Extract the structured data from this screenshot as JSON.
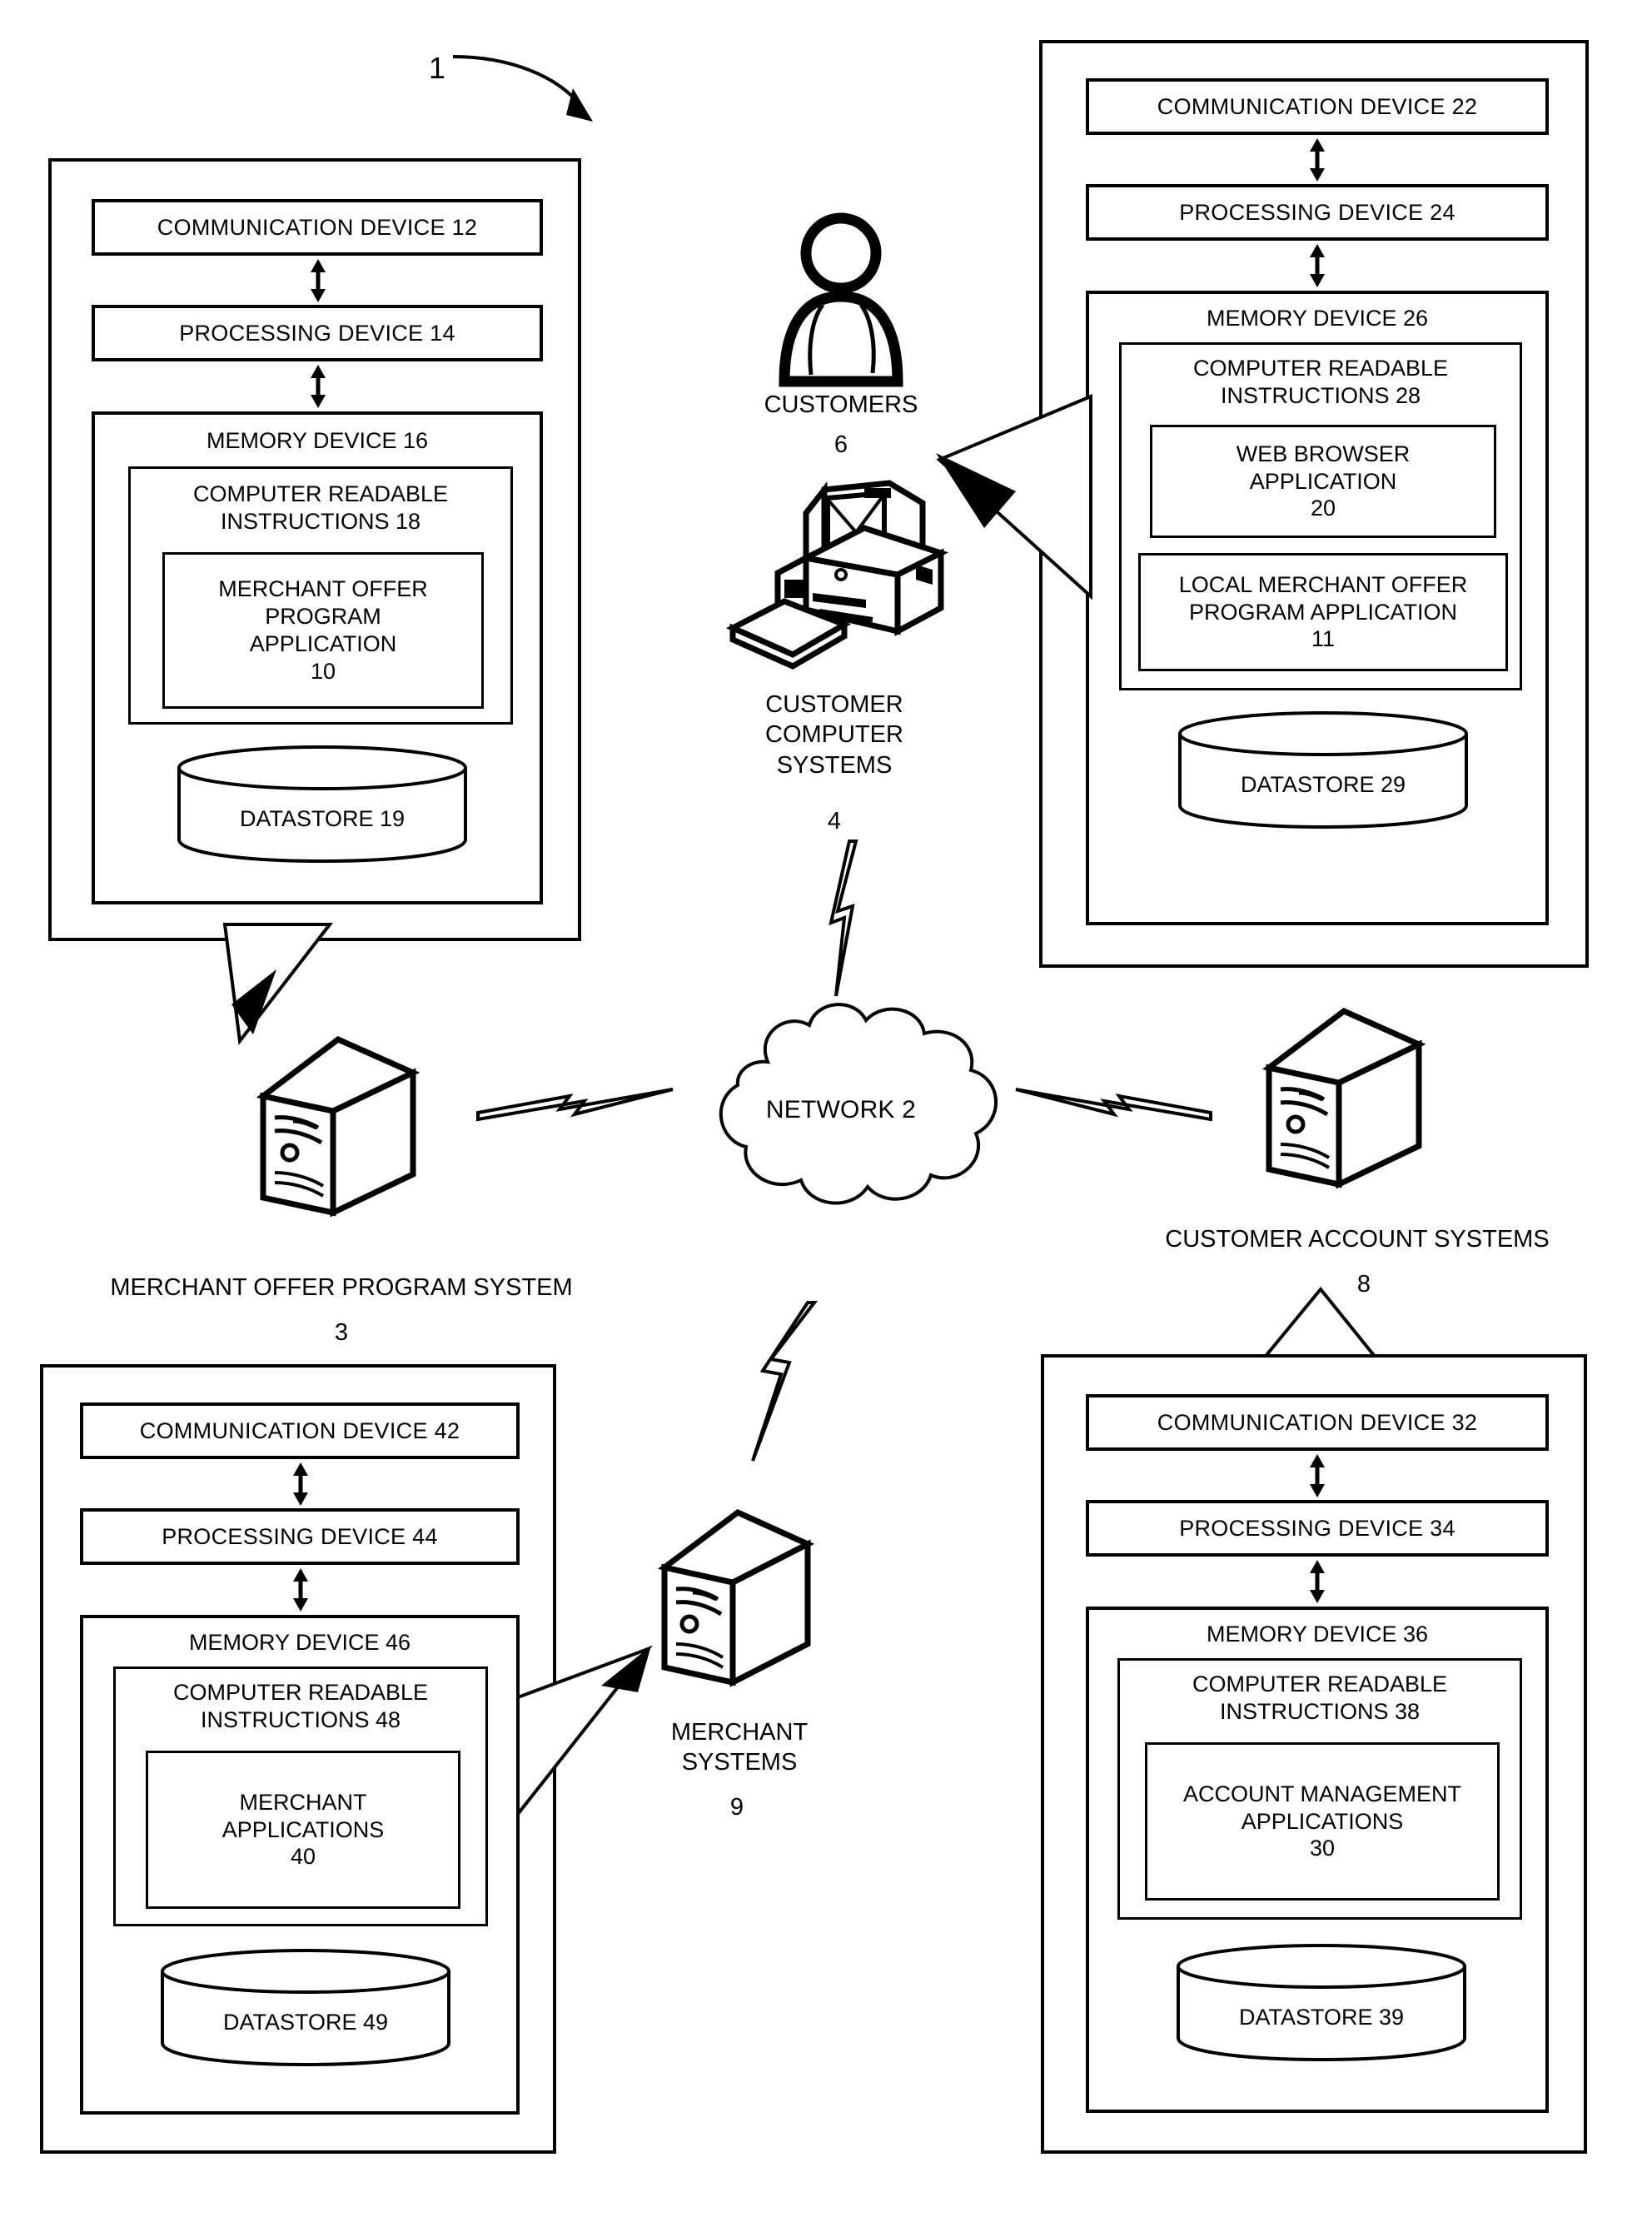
{
  "figure": {
    "number": "1",
    "title": "System architecture diagram"
  },
  "systems": {
    "merchant_offer_program_system": {
      "name": "MERCHANT OFFER PROGRAM SYSTEM",
      "ref": "3",
      "communication_device": "COMMUNICATION DEVICE 12",
      "processing_device": "PROCESSING DEVICE 14",
      "memory_device": "MEMORY DEVICE 16",
      "computer_readable_instructions": "COMPUTER READABLE\nINSTRUCTIONS 18",
      "application": "MERCHANT OFFER\nPROGRAM\nAPPLICATION\n10",
      "datastore": "DATASTORE 19"
    },
    "customer_computer_systems": {
      "name": "CUSTOMER\nCOMPUTER\nSYSTEMS",
      "ref": "4",
      "communication_device": "COMMUNICATION DEVICE 22",
      "processing_device": "PROCESSING DEVICE 24",
      "memory_device": "MEMORY DEVICE 26",
      "computer_readable_instructions": "COMPUTER READABLE\nINSTRUCTIONS 28",
      "application_1": "WEB BROWSER\nAPPLICATION\n20",
      "application_2": "LOCAL MERCHANT OFFER\nPROGRAM APPLICATION\n11",
      "datastore": "DATASTORE 29"
    },
    "merchant_systems": {
      "name": "MERCHANT\nSYSTEMS",
      "ref": "9",
      "communication_device": "COMMUNICATION DEVICE 42",
      "processing_device": "PROCESSING DEVICE 44",
      "memory_device": "MEMORY DEVICE 46",
      "computer_readable_instructions": "COMPUTER READABLE\nINSTRUCTIONS 48",
      "application": "MERCHANT\nAPPLICATIONS\n40",
      "datastore": "DATASTORE 49"
    },
    "customer_account_systems": {
      "name": "CUSTOMER ACCOUNT SYSTEMS",
      "ref": "8",
      "communication_device": "COMMUNICATION DEVICE 32",
      "processing_device": "PROCESSING DEVICE 34",
      "memory_device": "MEMORY DEVICE 36",
      "computer_readable_instructions": "COMPUTER READABLE\nINSTRUCTIONS 38",
      "application": "ACCOUNT MANAGEMENT\nAPPLICATIONS\n30",
      "datastore": "DATASTORE 39"
    }
  },
  "actors": {
    "customers": {
      "label": "CUSTOMERS",
      "ref": "6",
      "icon": "person-icon"
    }
  },
  "network": {
    "label": "NETWORK 2",
    "icon": "cloud-icon"
  },
  "icons": {
    "server_tower": "server-tower-icon",
    "desktop_computer": "desktop-computer-icon",
    "datastore_cylinder": "cylinder-icon",
    "lightning": "lightning-bolt-icon"
  },
  "colors": {
    "stroke": "#000000",
    "background": "#ffffff"
  }
}
